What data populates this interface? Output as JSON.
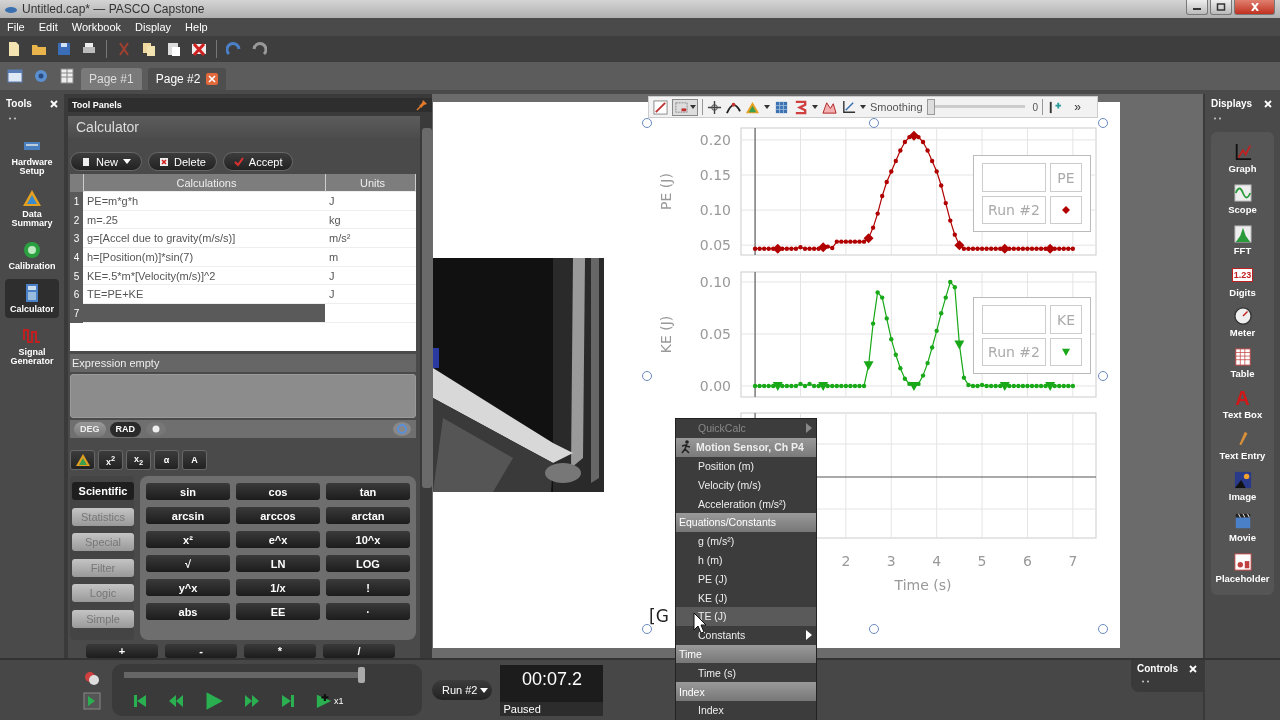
{
  "window": {
    "title": "Untitled.cap* — PASCO Capstone"
  },
  "menu_bar": [
    "File",
    "Edit",
    "Workbook",
    "Display",
    "Help"
  ],
  "page_tabs": [
    {
      "label": "Page #1",
      "selected": false
    },
    {
      "label": "Page #2",
      "selected": true
    }
  ],
  "tools": {
    "title": "Tools",
    "items": [
      {
        "label": "Hardware Setup",
        "kind": "hardware",
        "selected": false
      },
      {
        "label": "Data Summary",
        "kind": "data",
        "selected": false
      },
      {
        "label": "Calibration",
        "kind": "calibration",
        "selected": false
      },
      {
        "label": "Calculator",
        "kind": "calculator",
        "selected": true
      },
      {
        "label": "Signal Generator",
        "kind": "signal",
        "selected": false
      }
    ]
  },
  "tool_panels": {
    "title": "Tool Panels",
    "calculator": {
      "title": "Calculator",
      "buttons": [
        {
          "label": "New",
          "kind": "new"
        },
        {
          "label": "Delete",
          "kind": "delete"
        },
        {
          "label": "Accept",
          "kind": "accept"
        }
      ],
      "columns": [
        "Calculations",
        "Units"
      ],
      "rows": [
        {
          "num": "1",
          "calculation": "PE=m*g*h",
          "units": "J",
          "selected": false
        },
        {
          "num": "2",
          "calculation": "m=.25",
          "units": "kg",
          "selected": false
        },
        {
          "num": "3",
          "calculation": "g=[Accel due to gravity(m/s/s)]",
          "units": "m/s²",
          "selected": false
        },
        {
          "num": "4",
          "calculation": "h=[Position(m)]*sin(7)",
          "units": "m",
          "selected": false
        },
        {
          "num": "5",
          "calculation": "KE=.5*m*[Velocity(m/s)]^2",
          "units": "J",
          "selected": false
        },
        {
          "num": "6",
          "calculation": "TE=PE+KE",
          "units": "J",
          "selected": false
        },
        {
          "num": "7",
          "selected": true
        }
      ],
      "expression_label": "Expression empty",
      "angle_modes": [
        {
          "label": "DEG",
          "selected": false
        },
        {
          "label": "RAD",
          "selected": true
        }
      ],
      "symbol_tabs": [
        {
          "kind": "icon"
        },
        {
          "kind": "text",
          "label": "x$^{2}$"
        },
        {
          "kind": "text",
          "label": "x$_{2}$"
        },
        {
          "kind": "text",
          "label": "α"
        },
        {
          "kind": "text",
          "label": "A"
        }
      ],
      "categories": [
        {
          "label": "Scientific",
          "selected": true
        },
        {
          "label": "Statistics",
          "selected": false
        },
        {
          "label": "Special",
          "selected": false
        },
        {
          "label": "Filter",
          "selected": false
        },
        {
          "label": "Logic",
          "selected": false
        },
        {
          "label": "Simple",
          "selected": false
        }
      ],
      "keys": [
        "sin",
        "cos",
        "tan",
        "arcsin",
        "arccos",
        "arctan",
        "x²",
        "e^x",
        "10^x",
        "√",
        "LN",
        "LOG",
        "y^x",
        "1/x",
        "!",
        "abs",
        "EE",
        "·"
      ],
      "operator_keys": [
        "+",
        "-",
        "*",
        "/"
      ]
    }
  },
  "graph_toolbar": {
    "smoothing_label": "Smoothing",
    "smoothing": {
      "level": 0
    },
    "smoothing_value": "0",
    "more": "»"
  },
  "graphs": [
    {
      "legend": {
        "run": "Run #2",
        "kind": "diamond"
      },
      "chart_data": {
        "type": "line",
        "grid": true,
        "ylabel": "PE (J)",
        "ylim": [
          0.036,
          0.217
        ],
        "yticks": [
          {
            "value": 0.05,
            "label": "0.05"
          },
          {
            "value": 0.1,
            "label": "0.10"
          },
          {
            "value": 0.15,
            "label": "0.15"
          },
          {
            "value": 0.2,
            "label": "0.20"
          }
        ],
        "categories": [
          null,
          null,
          null,
          null,
          null,
          null,
          null,
          null,
          null,
          null,
          null,
          null,
          null,
          null,
          null,
          null,
          null,
          null,
          null,
          null,
          null,
          null,
          null,
          null,
          null,
          null,
          null,
          null,
          null,
          null,
          null,
          null,
          null,
          null,
          null,
          null,
          null,
          null,
          null,
          null,
          null,
          null,
          null,
          null,
          null,
          null,
          null,
          null,
          null,
          null,
          null,
          null,
          null,
          null,
          null,
          null,
          null,
          null,
          null,
          null,
          null,
          null,
          null,
          null,
          null,
          null,
          null,
          null,
          null,
          null,
          null
        ],
        "series": [
          {
            "name": "PE",
            "color": "#b00000",
            "values": [
              0.045,
              0.045,
              0.045,
              0.045,
              0.045,
              0.045,
              0.045,
              0.045,
              0.045,
              0.045,
              0.047,
              0.045,
              0.045,
              0.045,
              0.045,
              0.047,
              0.048,
              0.046,
              0.055,
              0.055,
              0.055,
              0.055,
              0.055,
              0.055,
              0.055,
              0.06,
              0.075,
              0.095,
              0.12,
              0.14,
              0.155,
              0.17,
              0.185,
              0.197,
              0.204,
              0.206,
              0.204,
              0.197,
              0.185,
              0.17,
              0.155,
              0.135,
              0.11,
              0.085,
              0.065,
              0.05,
              0.045,
              0.045,
              0.045,
              0.045,
              0.045,
              0.045,
              0.045,
              0.045,
              0.045,
              0.045,
              0.045,
              0.045,
              0.045,
              0.045,
              0.045,
              0.045,
              0.045,
              0.045,
              0.045,
              0.045,
              0.045,
              0.045,
              0.045,
              0.045,
              0.045
            ]
          }
        ]
      }
    },
    {
      "legend": {
        "run": "Run #2",
        "kind": "triangle"
      },
      "chart_data": {
        "type": "line",
        "grid": true,
        "ylabel": "KE (J)",
        "ylim": [
          -0.0106,
          0.1096
        ],
        "yticks": [
          {
            "value": 0,
            "label": "0.00"
          },
          {
            "value": 0.05,
            "label": "0.05"
          },
          {
            "value": 0.1,
            "label": "0.10"
          }
        ],
        "categories": [
          null,
          null,
          null,
          null,
          null,
          null,
          null,
          null,
          null,
          null,
          null,
          null,
          null,
          null,
          null,
          null,
          null,
          null,
          null,
          null,
          null,
          null,
          null,
          null,
          null,
          null,
          null,
          null,
          null,
          null,
          null,
          null,
          null,
          null,
          null,
          null,
          null,
          null,
          null,
          null,
          null,
          null,
          null,
          null,
          null,
          null,
          null,
          null,
          null,
          null,
          null,
          null,
          null,
          null,
          null,
          null,
          null,
          null,
          null,
          null,
          null,
          null,
          null,
          null,
          null,
          null,
          null,
          null,
          null,
          null,
          null
        ],
        "series": [
          {
            "name": "KE",
            "color": "#18a818",
            "values": [
              0,
              0,
              0,
              0,
              0,
              0,
              0,
              0,
              0,
              0,
              0.002,
              0,
              0.002,
              0,
              0,
              0,
              0,
              0,
              0,
              0,
              0,
              0,
              0,
              0,
              0,
              0.02,
              0.06,
              0.09,
              0.085,
              0.065,
              0.045,
              0.03,
              0.017,
              0.007,
              0.002,
              0,
              0.002,
              0.01,
              0.022,
              0.037,
              0.053,
              0.07,
              0.085,
              0.1,
              0.095,
              0.04,
              0.008,
              0.001,
              0,
              0,
              0.001,
              0,
              0,
              0,
              0,
              0,
              0,
              0,
              0,
              0,
              0,
              0,
              0,
              0,
              0,
              0,
              0,
              0,
              0,
              0,
              0
            ]
          }
        ]
      }
    },
    {
      "axis": {
        "ticks": [
          "2",
          "3",
          "4",
          "5",
          "6",
          "7"
        ],
        "label": "Time (s)"
      }
    }
  ],
  "page_text": "[G",
  "context_menu": [
    {
      "kind": "disabled",
      "label": "QuickCalc",
      "submenu": true,
      "selected": false
    },
    {
      "kind": "sensor",
      "label": "Motion Sensor, Ch P4",
      "submenu": false,
      "selected": false
    },
    {
      "kind": "item",
      "label": "Position (m)",
      "submenu": false,
      "selected": false
    },
    {
      "kind": "item",
      "label": "Velocity (m/s)",
      "submenu": false,
      "selected": false
    },
    {
      "kind": "item",
      "label": "Acceleration (m/s²)",
      "submenu": false,
      "selected": false
    },
    {
      "kind": "header",
      "label": "Equations/Constants",
      "submenu": false,
      "selected": false
    },
    {
      "kind": "item",
      "label": "g (m/s²)",
      "submenu": false,
      "selected": false
    },
    {
      "kind": "item",
      "label": "h (m)",
      "submenu": false,
      "selected": false
    },
    {
      "kind": "item",
      "label": "PE (J)",
      "submenu": false,
      "selected": false
    },
    {
      "kind": "item",
      "label": "KE (J)",
      "submenu": false,
      "selected": false
    },
    {
      "kind": "item",
      "label": "TE (J)",
      "submenu": false,
      "selected": true
    },
    {
      "kind": "item",
      "label": "Constants",
      "submenu": true,
      "selected": false
    },
    {
      "kind": "header",
      "label": "Time",
      "submenu": false,
      "selected": false
    },
    {
      "kind": "item",
      "label": "Time (s)",
      "submenu": false,
      "selected": false
    },
    {
      "kind": "header",
      "label": "Index",
      "submenu": false,
      "selected": false
    },
    {
      "kind": "item",
      "label": "Index",
      "submenu": false,
      "selected": false
    }
  ],
  "displays": {
    "title": "Displays",
    "items": [
      {
        "label": "Graph",
        "kind": "graph"
      },
      {
        "label": "Scope",
        "kind": "scope"
      },
      {
        "label": "FFT",
        "kind": "fft"
      },
      {
        "label": "Digits",
        "kind": "digits",
        "icon_text": "1.23"
      },
      {
        "label": "Meter",
        "kind": "meter"
      },
      {
        "label": "Table",
        "kind": "table"
      },
      {
        "label": "Text Box",
        "kind": "textbox",
        "icon_text": "A"
      },
      {
        "label": "Text Entry",
        "kind": "textentry"
      },
      {
        "label": "Image"
      },
      {
        "label": "Movie",
        "kind": "movie"
      },
      {
        "label": "Placeholder",
        "kind": "placeholder"
      }
    ]
  },
  "controls_panel": {
    "title": "Controls"
  },
  "playback": {
    "level": 0.97,
    "run": "Run #2",
    "speed": "x1",
    "time": "00:07.2",
    "status": "Paused"
  }
}
